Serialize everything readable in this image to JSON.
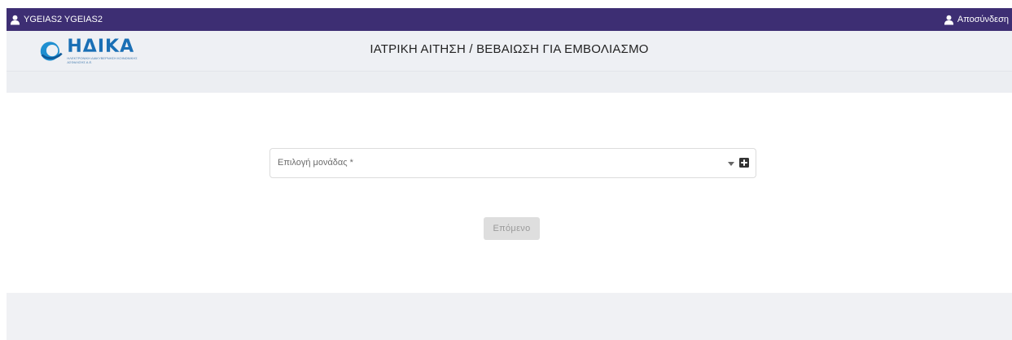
{
  "topbar": {
    "user_name": "YGEIAS2 YGEIAS2",
    "logout_label": "Αποσύνδεση",
    "bg_color": "#3d2e73"
  },
  "header": {
    "logo_text": "ΗΔΙΚΑ",
    "logo_subtext": "ΗΛΕΚΤΡΟΝΙΚΗ ΔΙΑΚΥΒΕΡΝΗΣΗ ΚΟΙΝΩΝΙΚΗΣ ΑΣΦΑΛΙΣΗΣ Α.Ε.",
    "title": "ΙΑΤΡΙΚΗ ΑΙΤΗΣΗ / ΒΕΒΑΙΩΣΗ ΓΙΑ ΕΜΒΟΛΙΑΣΜΟ"
  },
  "form": {
    "unit_select_label": "Επιλογή μονάδας *",
    "next_button_label": "Επόμενο"
  },
  "icons": {
    "user": "user-icon",
    "logout": "user-icon",
    "dropdown": "caret-down-icon",
    "add": "plus-square-icon"
  }
}
